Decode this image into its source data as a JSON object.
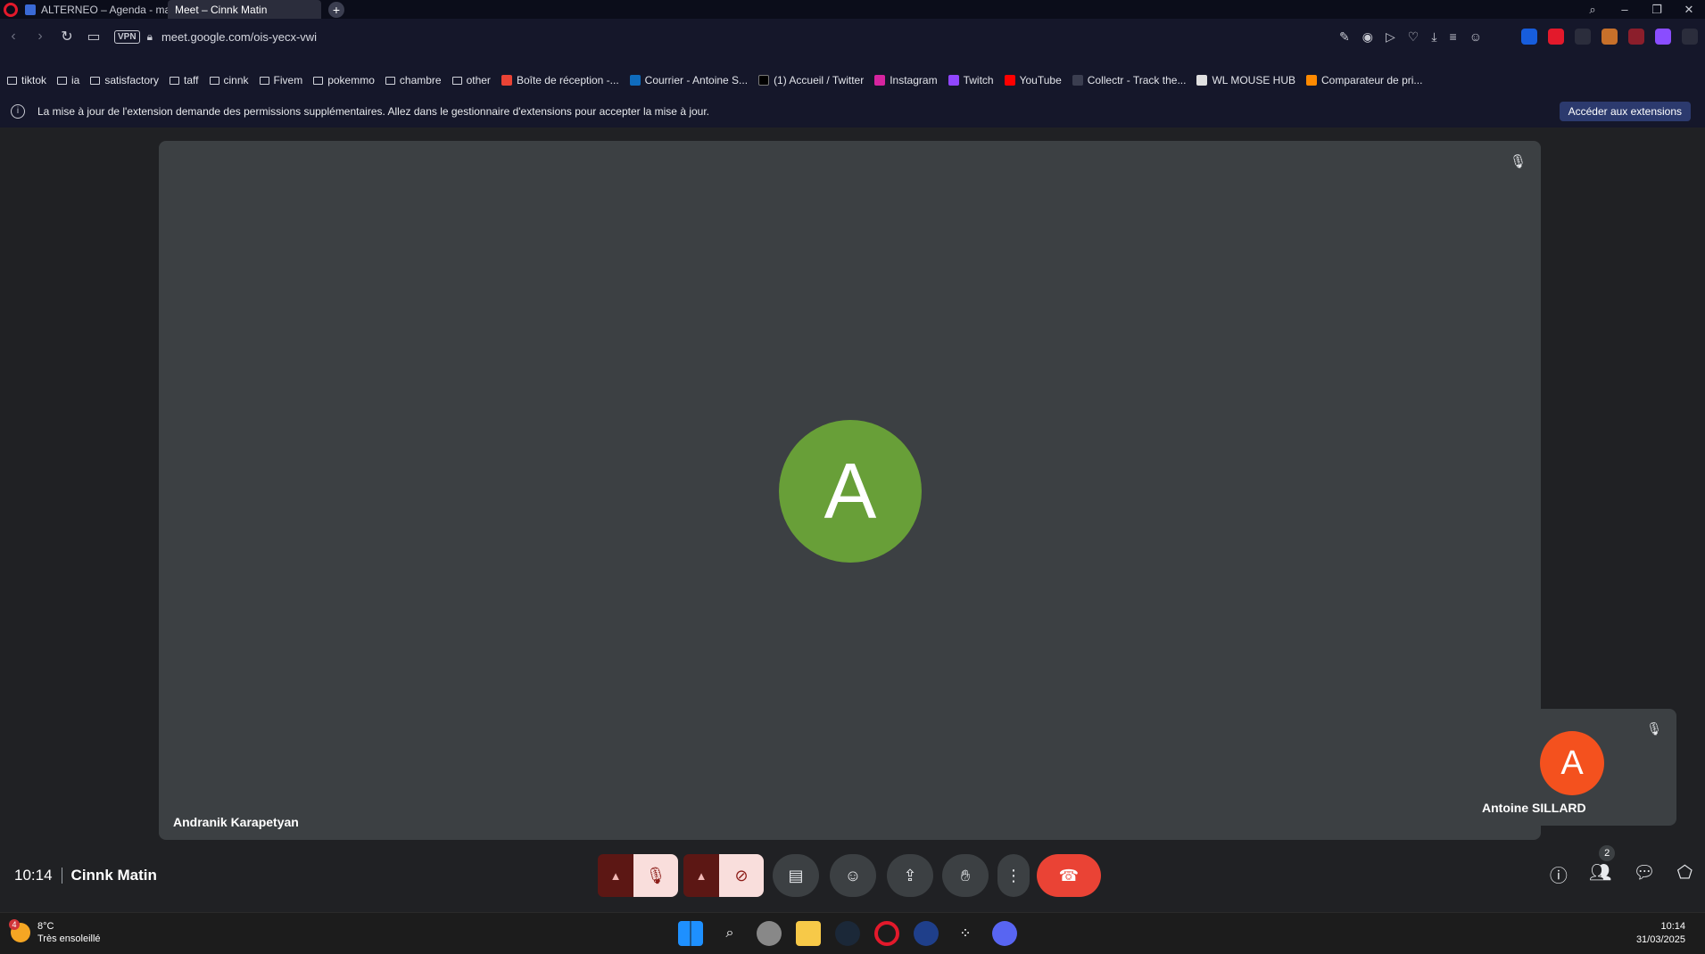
{
  "tabs": [
    {
      "title": "ALTERNEO – Agenda - ma",
      "active": false
    },
    {
      "title": "Meet – Cinnk Matin",
      "active": true
    }
  ],
  "address": {
    "url": "meet.google.com/ois-yecx-vwi",
    "vpn_label": "VPN"
  },
  "bookmarks": [
    {
      "label": "tiktok",
      "kind": "folder"
    },
    {
      "label": "ia",
      "kind": "folder"
    },
    {
      "label": "satisfactory",
      "kind": "folder"
    },
    {
      "label": "taff",
      "kind": "folder"
    },
    {
      "label": "cinnk",
      "kind": "folder"
    },
    {
      "label": "Fivem",
      "kind": "folder"
    },
    {
      "label": "pokemmo",
      "kind": "folder"
    },
    {
      "label": "chambre",
      "kind": "folder"
    },
    {
      "label": "other",
      "kind": "folder"
    },
    {
      "label": "Boîte de réception -...",
      "kind": "link",
      "color": "#ea4335"
    },
    {
      "label": "Courrier - Antoine S...",
      "kind": "link",
      "color": "#0f6cbd"
    },
    {
      "label": "(1) Accueil / Twitter",
      "kind": "link",
      "color": "#000000"
    },
    {
      "label": "Instagram",
      "kind": "link",
      "color": "#d6249f"
    },
    {
      "label": "Twitch",
      "kind": "link",
      "color": "#9146ff"
    },
    {
      "label": "YouTube",
      "kind": "link",
      "color": "#ff0000"
    },
    {
      "label": "Collectr - Track the...",
      "kind": "link",
      "color": "#3b3e50"
    },
    {
      "label": "WL MOUSE HUB",
      "kind": "link",
      "color": "#e0e0e0"
    },
    {
      "label": "Comparateur de pri...",
      "kind": "link",
      "color": "#ff8a00"
    }
  ],
  "infobar": {
    "message": "La mise à jour de l'extension demande des permissions supplémentaires. Allez dans le gestionnaire d'extensions pour accepter la mise à jour.",
    "button": "Accéder aux extensions"
  },
  "meeting": {
    "time": "10:14",
    "title": "Cinnk Matin",
    "participant_count": "2",
    "main_participant": {
      "name": "Andranik Karapetyan",
      "initial": "A",
      "color": "#689f38"
    },
    "self_participant": {
      "name": "Antoine SILLARD",
      "initial": "A",
      "color": "#f4511e"
    }
  },
  "taskbar": {
    "weather_temp": "8°C",
    "weather_desc": "Très ensoleillé",
    "weather_badge": "4",
    "clock_time": "10:14",
    "clock_date": "31/03/2025"
  }
}
